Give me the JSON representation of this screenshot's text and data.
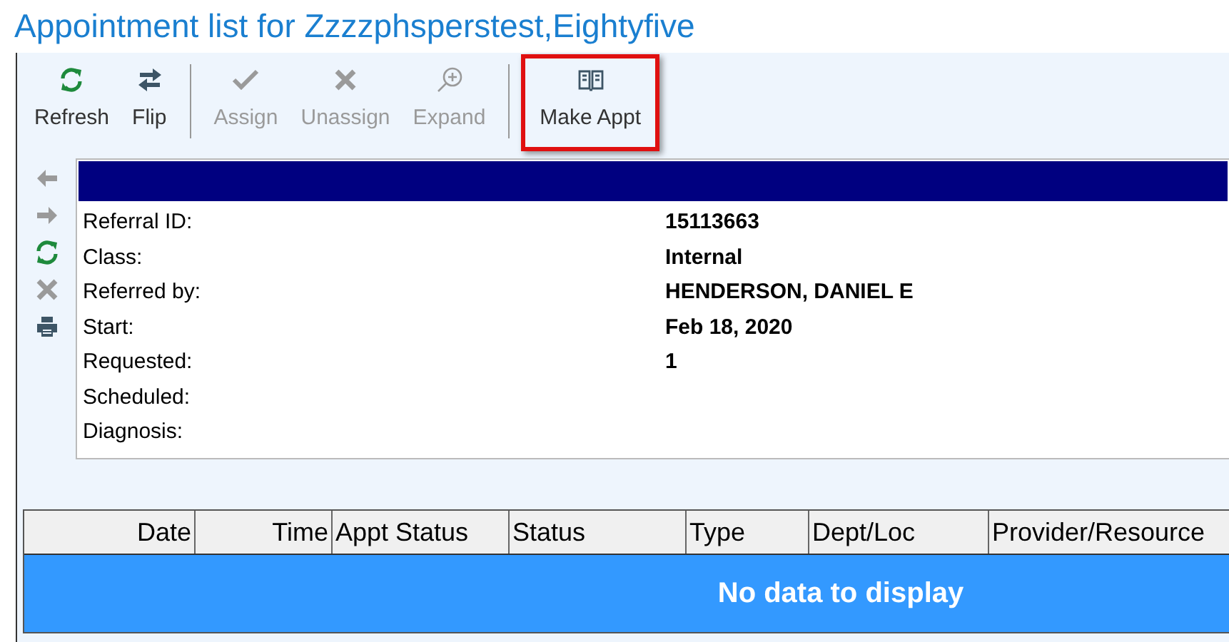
{
  "title": "Appointment list for Zzzzphsperstest,Eightyfive",
  "toolbar": [
    {
      "kind": "refresh",
      "label": "Refresh",
      "disabled": false,
      "highlighted": false,
      "separator_before": false
    },
    {
      "kind": "flip",
      "label": "Flip",
      "disabled": false,
      "highlighted": false,
      "separator_before": false
    },
    {
      "kind": "assign",
      "label": "Assign",
      "disabled": true,
      "highlighted": false,
      "separator_before": true
    },
    {
      "kind": "unassign",
      "label": "Unassign",
      "disabled": true,
      "highlighted": false,
      "separator_before": false
    },
    {
      "kind": "expand",
      "label": "Expand",
      "disabled": true,
      "highlighted": false,
      "separator_before": false
    },
    {
      "kind": "book",
      "label": "Make Appt",
      "disabled": false,
      "highlighted": true,
      "separator_before": true
    }
  ],
  "side_tools": [
    {
      "kind": "back",
      "disabled": true
    },
    {
      "kind": "forward",
      "disabled": true
    },
    {
      "kind": "refresh",
      "disabled": false
    },
    {
      "kind": "delete",
      "disabled": true
    },
    {
      "kind": "print",
      "disabled": false
    }
  ],
  "details": [
    {
      "label": "Referral ID:",
      "value": "15113663"
    },
    {
      "label": "Class:",
      "value": "Internal"
    },
    {
      "label": "Referred by:",
      "value": "HENDERSON, DANIEL E"
    },
    {
      "label": "Start:",
      "value": "Feb 18, 2020"
    },
    {
      "label": "Requested:",
      "value": "1"
    },
    {
      "label": "Scheduled:"
    },
    {
      "label": "Diagnosis:"
    }
  ],
  "table": {
    "columns": [
      {
        "label": "Date",
        "right_aligned": true
      },
      {
        "label": "Time",
        "right_aligned": true
      },
      {
        "label": "Appt Status",
        "right_aligned": false
      },
      {
        "label": "Status",
        "right_aligned": false
      },
      {
        "label": "Type",
        "right_aligned": false
      },
      {
        "label": "Dept/Loc",
        "right_aligned": false
      },
      {
        "label": "Provider/Resource",
        "right_aligned": false
      }
    ],
    "empty_message": "No data to display"
  }
}
